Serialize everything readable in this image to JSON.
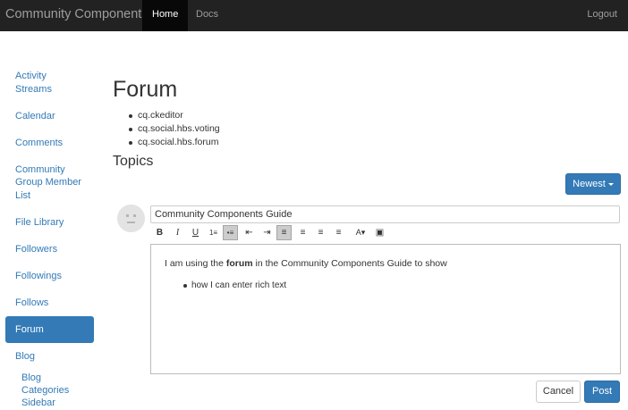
{
  "navbar": {
    "brand": "Community Components",
    "items": [
      {
        "label": "Home",
        "active": true
      },
      {
        "label": "Docs",
        "active": false
      }
    ],
    "logout": "Logout"
  },
  "sidebar": {
    "items": [
      {
        "label": "Activity Streams"
      },
      {
        "label": "Calendar"
      },
      {
        "label": "Comments"
      },
      {
        "label": "Community Group Member List"
      },
      {
        "label": "File Library"
      },
      {
        "label": "Followers"
      },
      {
        "label": "Followings"
      },
      {
        "label": "Follows"
      },
      {
        "label": "Forum",
        "active": true
      },
      {
        "label": "Blog"
      }
    ],
    "sub_items": [
      {
        "label": "Blog"
      },
      {
        "label": "Categories"
      },
      {
        "label": "Sidebar"
      }
    ]
  },
  "main": {
    "title": "Forum",
    "dependencies": [
      "cq.ckeditor",
      "cq.social.hbs.voting",
      "cq.social.hbs.forum"
    ],
    "topics_heading": "Topics",
    "sort_button": "Newest"
  },
  "composer": {
    "subject_value": "Community Components Guide",
    "toolbar": [
      {
        "icon": "bold-icon",
        "glyph": "B"
      },
      {
        "icon": "italic-icon",
        "glyph": "I"
      },
      {
        "icon": "underline-icon",
        "glyph": "U"
      },
      {
        "icon": "numbered-list-icon",
        "glyph": "1≡"
      },
      {
        "icon": "bulleted-list-icon",
        "glyph": "•≡",
        "active": true
      },
      {
        "icon": "decrease-indent-icon",
        "glyph": "⇤"
      },
      {
        "icon": "increase-indent-icon",
        "glyph": "⇥"
      },
      {
        "icon": "align-left-icon",
        "glyph": "≡",
        "active": true
      },
      {
        "icon": "align-center-icon",
        "glyph": "≡"
      },
      {
        "icon": "align-right-icon",
        "glyph": "≡"
      },
      {
        "icon": "justify-icon",
        "glyph": "≡"
      },
      {
        "icon": "text-color-icon",
        "glyph": "A▾"
      },
      {
        "icon": "image-icon",
        "glyph": "▣"
      }
    ],
    "body": {
      "text_before": "I am using the ",
      "bold": "forum",
      "text_after": " in the Community Components Guide to show",
      "bullet": "how I can enter rich text"
    },
    "cancel_label": "Cancel",
    "post_label": "Post"
  }
}
